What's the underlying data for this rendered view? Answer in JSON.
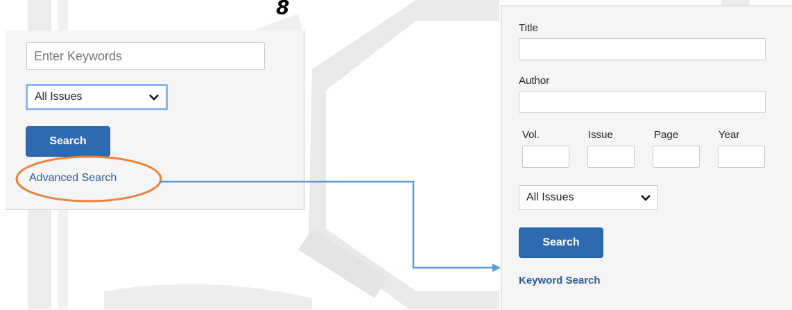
{
  "slide": {
    "page_number": "8"
  },
  "basic_search": {
    "keywords_placeholder": "Enter Keywords",
    "issue_select_value": "All Issues",
    "search_label": "Search",
    "advanced_link": "Advanced Search"
  },
  "advanced_search": {
    "title_label": "Title",
    "author_label": "Author",
    "vol_label": "Vol.",
    "issue_label": "Issue",
    "page_label": "Page",
    "year_label": "Year",
    "issue_select_value": "All Issues",
    "search_label": "Search",
    "keyword_link": "Keyword Search"
  },
  "colors": {
    "button": "#2d6ab0",
    "link": "#2d5a96",
    "highlight_ellipse": "#e8823a",
    "arrow": "#5b9bd5",
    "focus_ring": "#8ab4f0"
  },
  "icons": [
    "chevron-down-icon",
    "arrow-connector"
  ]
}
